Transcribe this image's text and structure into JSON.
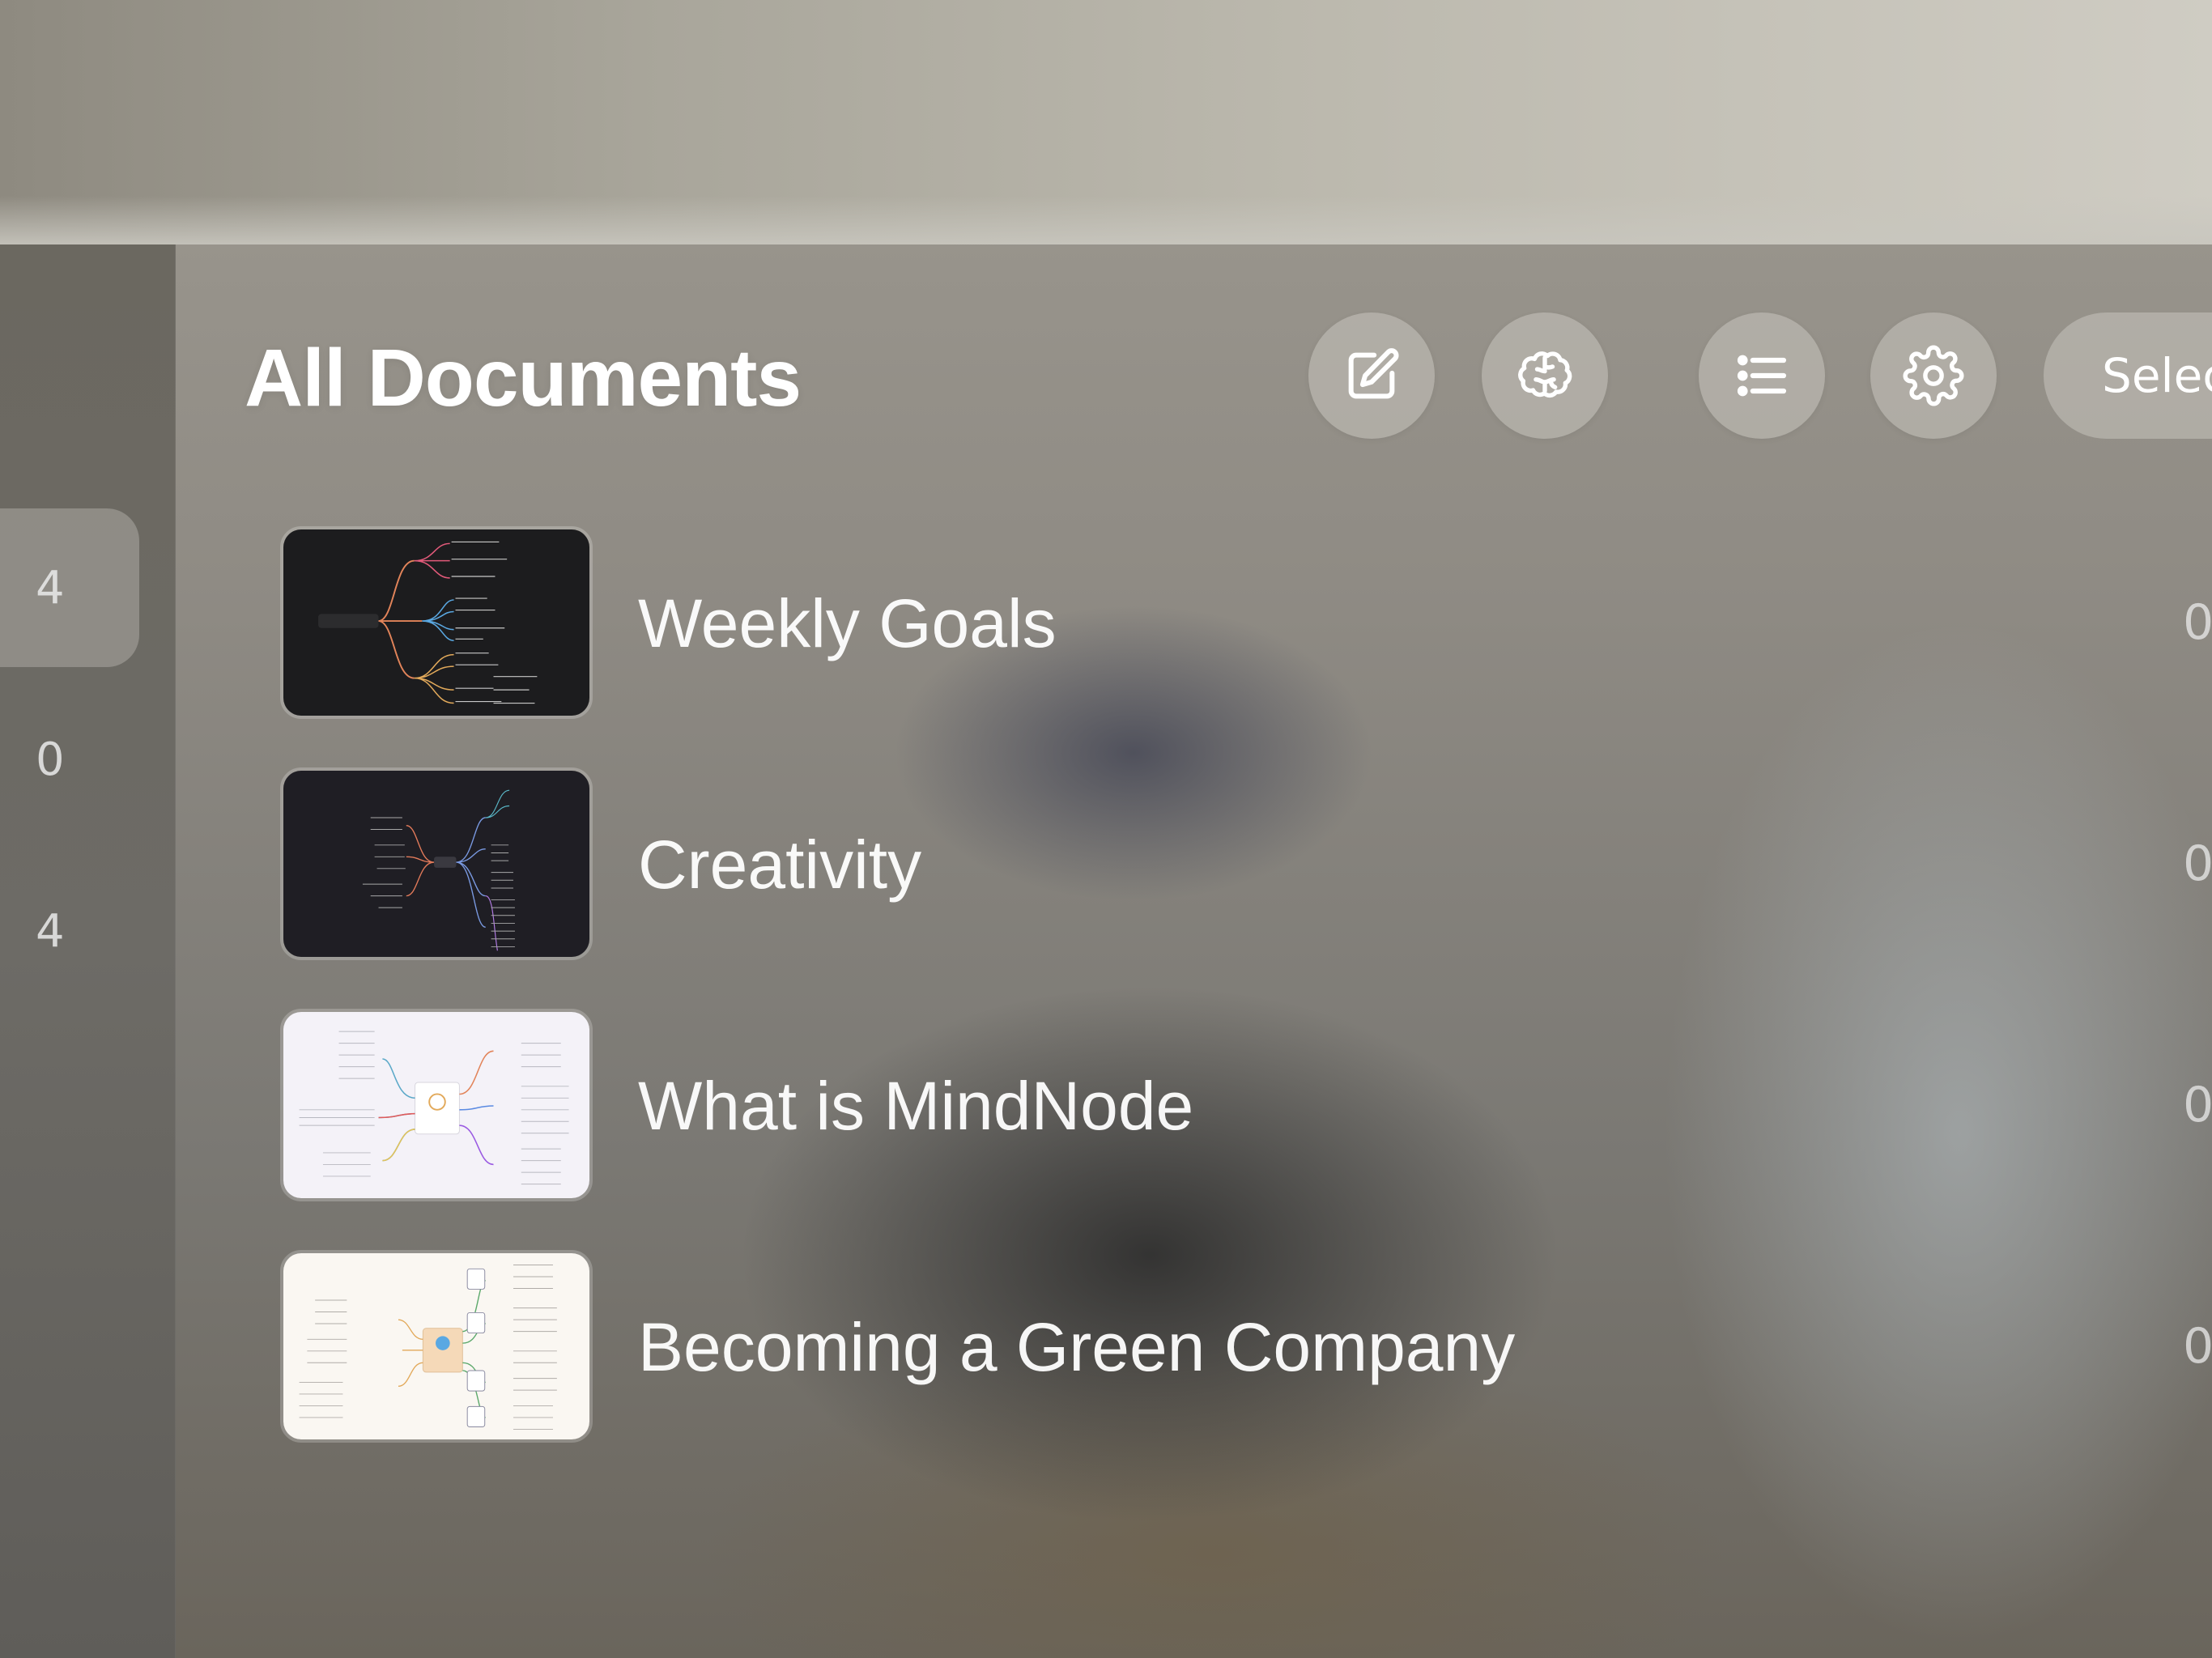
{
  "header": {
    "title": "All Documents",
    "select_label": "Selec"
  },
  "toolbar": {
    "buttons": [
      {
        "name": "new-document",
        "icon": "compose-icon"
      },
      {
        "name": "brain",
        "icon": "brain-icon"
      },
      {
        "name": "list-view",
        "icon": "list-icon"
      },
      {
        "name": "settings",
        "icon": "gear-icon"
      }
    ]
  },
  "sidebar": {
    "items": [
      {
        "count": "4",
        "selected": true
      },
      {
        "count": "0",
        "selected": false
      },
      {
        "count": "4",
        "selected": false
      }
    ]
  },
  "documents": [
    {
      "title": "Weekly Goals",
      "meta": "0",
      "thumbnail_theme": "dark"
    },
    {
      "title": "Creativity",
      "meta": "0",
      "thumbnail_theme": "dark"
    },
    {
      "title": "What is MindNode",
      "meta": "0",
      "thumbnail_theme": "light"
    },
    {
      "title": "Becoming a Green Company",
      "meta": "0",
      "thumbnail_theme": "light"
    }
  ],
  "colors": {
    "title_text": "#ffffff",
    "button_fill": "#d7d4cd",
    "thumb_dark": "#1c1c1e",
    "thumb_light": "#f6f4f8"
  }
}
